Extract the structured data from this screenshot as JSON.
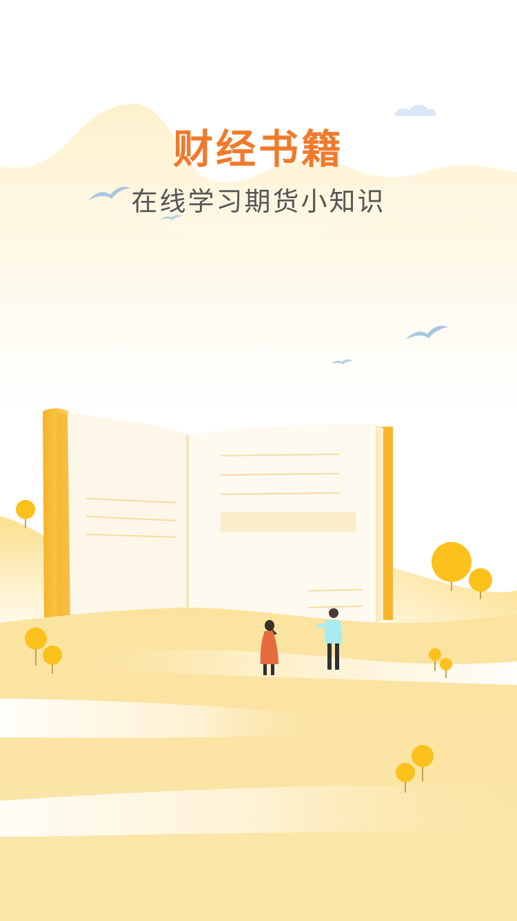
{
  "splash": {
    "title": "财经书籍",
    "subtitle": "在线学习期货小知识"
  },
  "colors": {
    "title": "#f07a2c",
    "subtitle": "#555555",
    "sand": "#fbe5a0",
    "tree": "#fdc11c",
    "book_cover": "#f7b730",
    "bird": "#a9c6e0"
  },
  "icons": [
    "cloud-icon",
    "bird-icon",
    "tree-icon",
    "book-illustration",
    "person-icon"
  ]
}
